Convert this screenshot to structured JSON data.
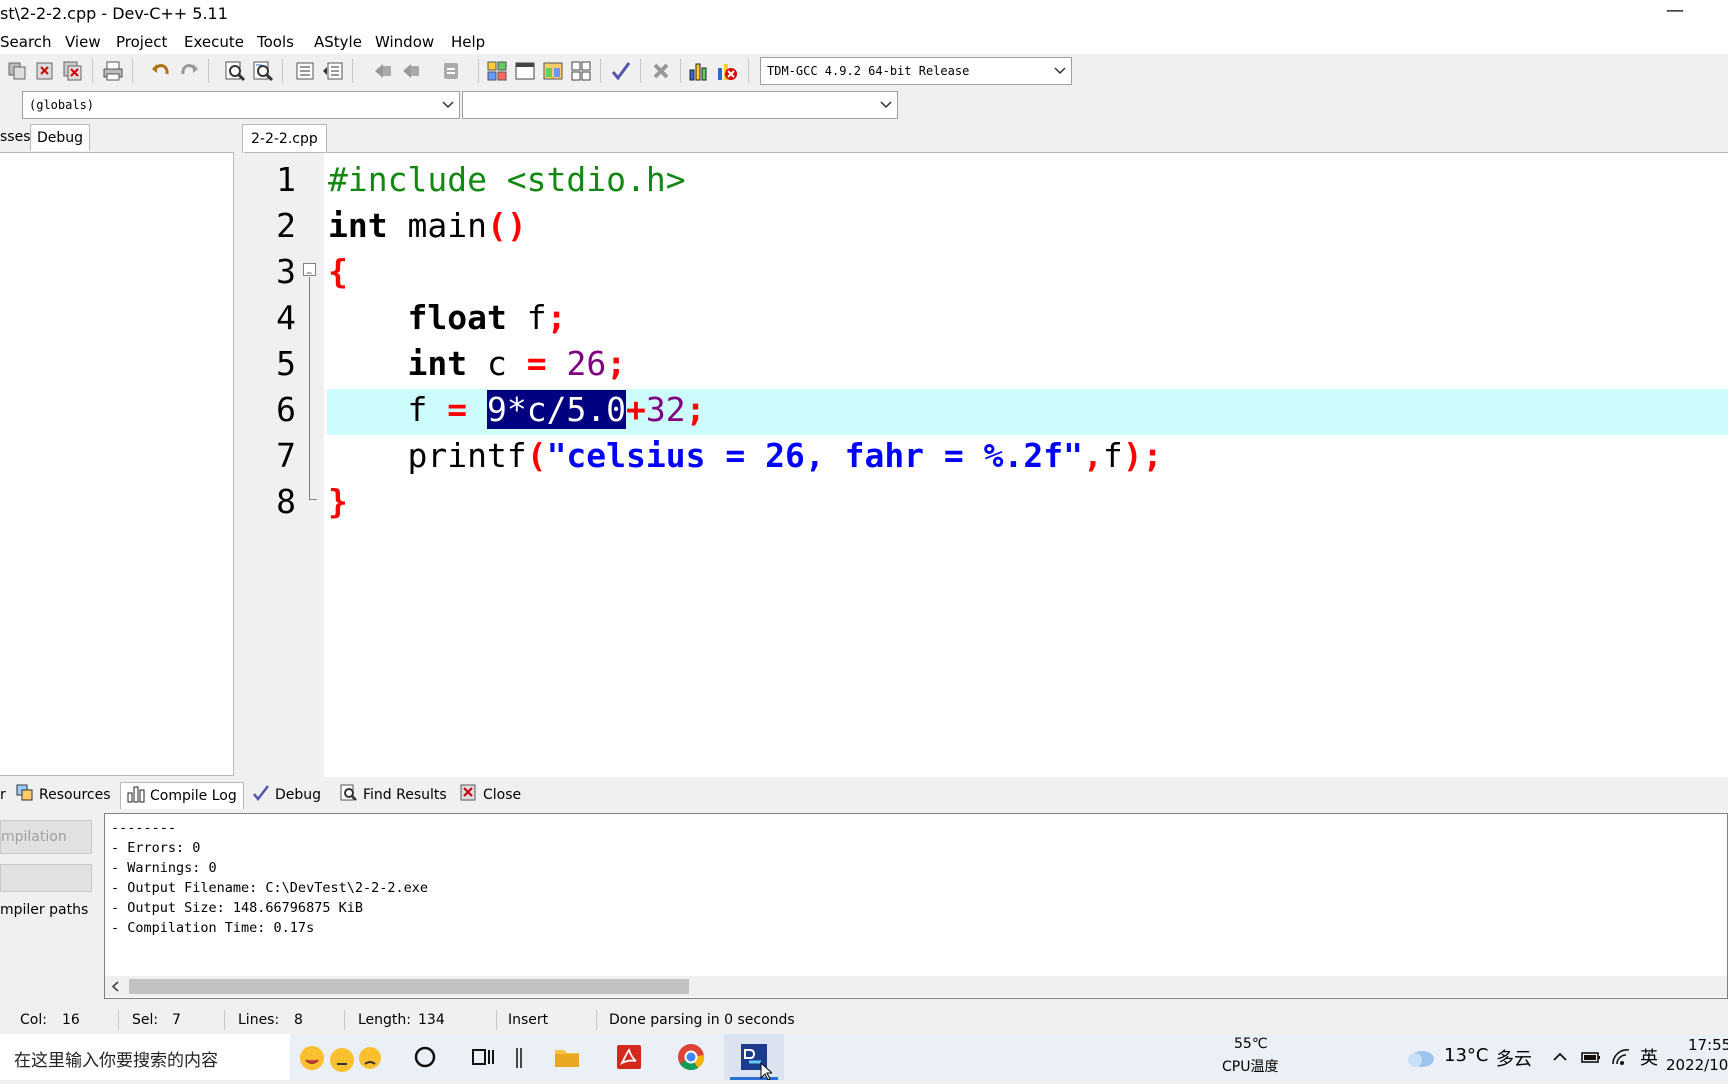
{
  "window": {
    "title": "st\\2-2-2.cpp - Dev-C++ 5.11",
    "minimize_glyph": "—"
  },
  "menu": [
    "Search",
    "View",
    "Project",
    "Execute",
    "Tools",
    "AStyle",
    "Window",
    "Help"
  ],
  "toolbar": {
    "compiler": "TDM-GCC 4.9.2 64-bit Release",
    "icons": [
      "copy-icon",
      "close-file-icon",
      "close-all-icon",
      "print-icon",
      "undo-icon",
      "redo-icon",
      "find-icon",
      "replace-icon",
      "indent-icon",
      "unindent-icon",
      "back-icon",
      "forward-icon",
      "bookmark-icon",
      "new-project-icon",
      "window-icon",
      "class-icon",
      "grid-icon",
      "check-icon",
      "x-icon",
      "chart-icon",
      "stop-icon"
    ]
  },
  "scope": {
    "globals": "(globals)",
    "functions": ""
  },
  "left_panel": {
    "tab_partial": "sses",
    "tab_debug": "Debug"
  },
  "editor": {
    "file_tab": "2-2-2.cpp",
    "line_numbers": [
      "1",
      "2",
      "3",
      "4",
      "5",
      "6",
      "7",
      "8"
    ]
  },
  "bottom_tabs": {
    "partial": "r",
    "resources": "Resources",
    "compile_log": "Compile Log",
    "debug": "Debug",
    "find_results": "Find Results",
    "close": "Close"
  },
  "bottom_left": {
    "abort_button": "mpilation",
    "compiler_paths": "mpiler paths"
  },
  "compile_log": [
    "--------",
    "- Errors: 0",
    "- Warnings: 0",
    "- Output Filename: C:\\DevTest\\2-2-2.exe",
    "- Output Size: 148.66796875 KiB",
    "- Compilation Time: 0.17s"
  ],
  "status": {
    "col_label": "Col:",
    "col": "16",
    "sel_label": "Sel:",
    "sel": "7",
    "lines_label": "Lines:",
    "lines": "8",
    "length_label": "Length:",
    "length": "134",
    "mode": "Insert",
    "message": "Done parsing in 0 seconds"
  },
  "taskbar": {
    "search_placeholder": "在这里输入你要搜索的内容",
    "cpu_temp": "55℃",
    "cpu_label": "CPU温度",
    "weather_temp": "13°C",
    "weather_desc": "多云",
    "ime": "英",
    "time": "17:55",
    "date": "2022/10"
  },
  "colors": {
    "accent": "#000080",
    "line_highlight": "#ccfcfc",
    "keyword_red": "#ff0000",
    "string_blue": "#0000ff",
    "number_purple": "#800080",
    "preproc_green": "#118811"
  }
}
